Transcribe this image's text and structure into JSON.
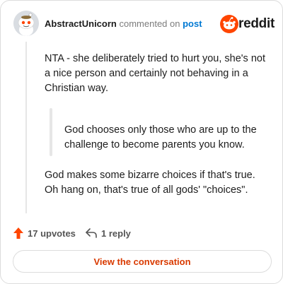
{
  "header": {
    "username": "AbstractUnicorn",
    "commented_on": "commented on",
    "post_link": "post",
    "brand": "reddit"
  },
  "comment": {
    "paragraph_1": "NTA - she deliberately tried to hurt you, she's not a nice person and certainly not behaving in a Christian way.",
    "quote": "God chooses only those who are up to the challenge to become parents you know.",
    "paragraph_2": "God makes some bizarre choices if that's true. Oh hang on, that's true of all gods' \"choices\"."
  },
  "actions": {
    "upvotes": "17 upvotes",
    "replies": "1 reply"
  },
  "cta": {
    "label": "View the conversation"
  },
  "colors": {
    "accent": "#ff4500",
    "link": "#0079d3",
    "cta_text": "#d93a00"
  },
  "icons": {
    "avatar": "snoo-avatar",
    "logo": "reddit-logo-icon",
    "upvote": "upvote-arrow-icon",
    "reply": "reply-arrow-icon"
  }
}
